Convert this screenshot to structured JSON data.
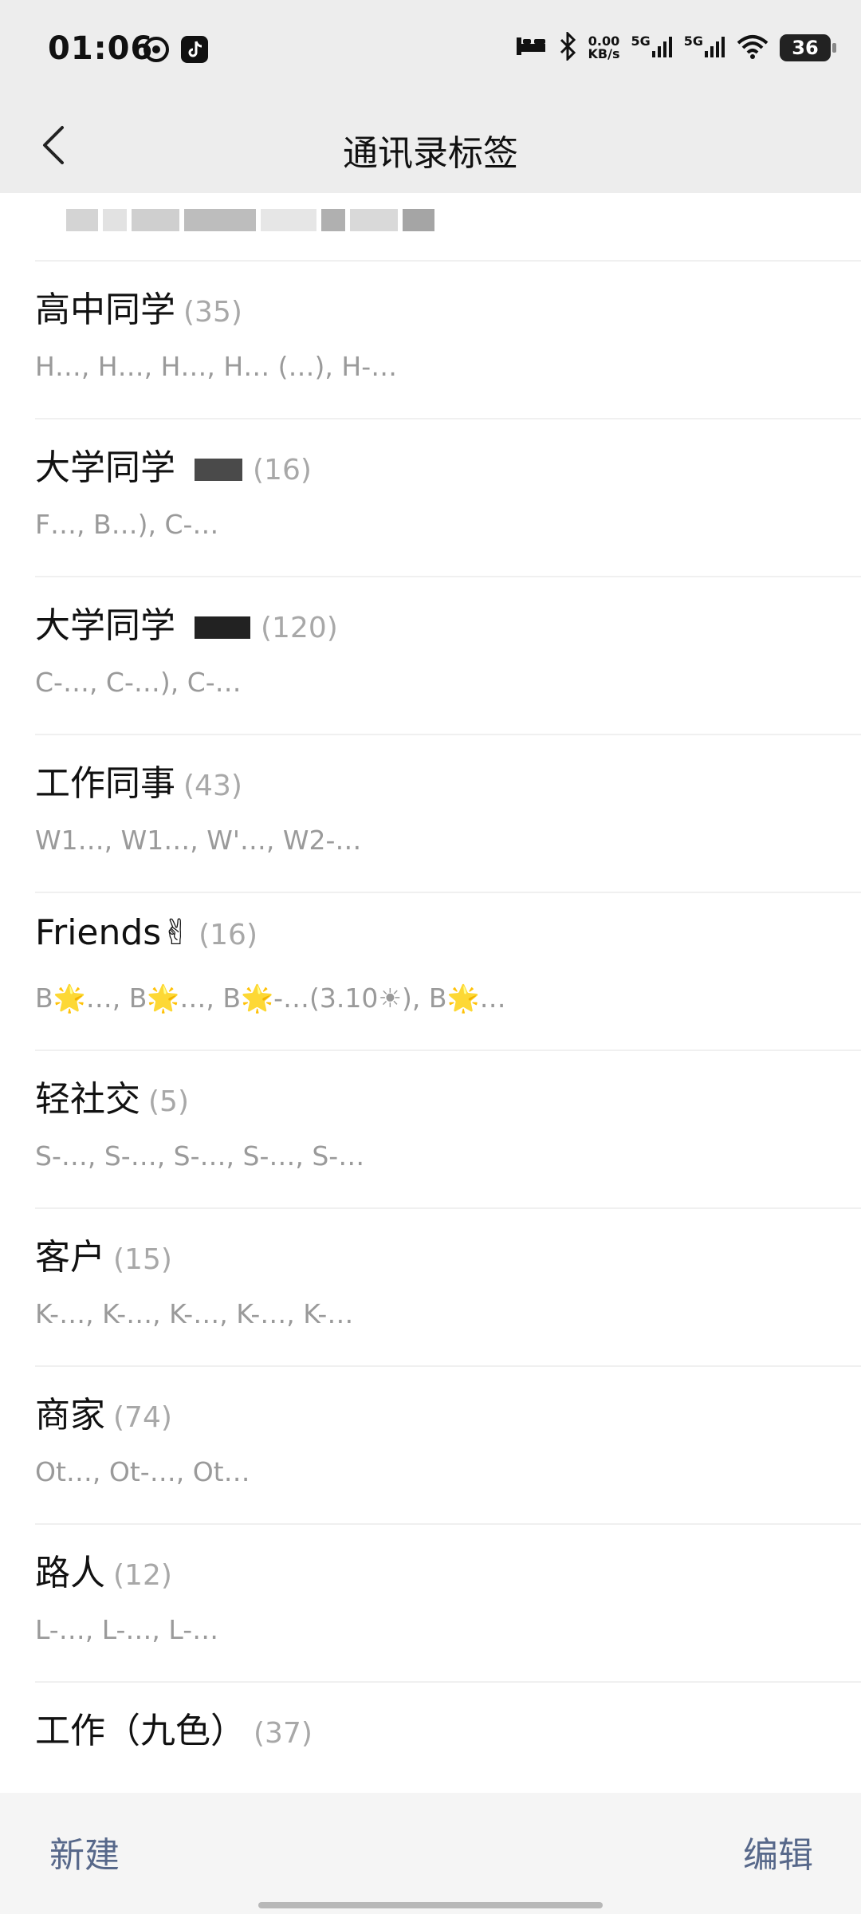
{
  "status_bar": {
    "time": "01:06",
    "net_speed_value": "0.00",
    "net_speed_unit": "KB/s",
    "sim1": "5G",
    "sim2": "5G",
    "battery": "36"
  },
  "header": {
    "title": "通讯录标签"
  },
  "tags": [
    {
      "title": "高中同学",
      "count": "(35)",
      "members": "H…, H…, H…, H… (…), H-…"
    },
    {
      "title": "大学同学",
      "count": "(16)",
      "members": "F…, B…), C-…"
    },
    {
      "title": "大学同学",
      "count": "(120)",
      "members": "C-…, C-…), C-…"
    },
    {
      "title": "工作同事",
      "count": "(43)",
      "members": "W1…, W1…, W'…, W2-…"
    },
    {
      "title": "Friends✌",
      "count": "(16)",
      "members": "B🌟…, B🌟…, B🌟-…(3.10☀), B🌟…"
    },
    {
      "title": "轻社交",
      "count": "(5)",
      "members": "S-…, S-…, S-…, S-…, S-…"
    },
    {
      "title": "客户",
      "count": "(15)",
      "members": "K-…, K-…, K-…, K-…, K-…"
    },
    {
      "title": "商家",
      "count": "(74)",
      "members": "Ot…, Ot-…, Ot…"
    },
    {
      "title": "路人",
      "count": "(12)",
      "members": "L-…, L-…, L-…"
    },
    {
      "title": "工作（九色）",
      "count": "(37)",
      "members": ""
    }
  ],
  "bottom_bar": {
    "new_label": "新建",
    "edit_label": "编辑"
  },
  "colors": {
    "accent": "#57688a",
    "header_bg": "#ededed",
    "divider": "#f0f0f0",
    "count_gray": "#a8a8a8"
  }
}
